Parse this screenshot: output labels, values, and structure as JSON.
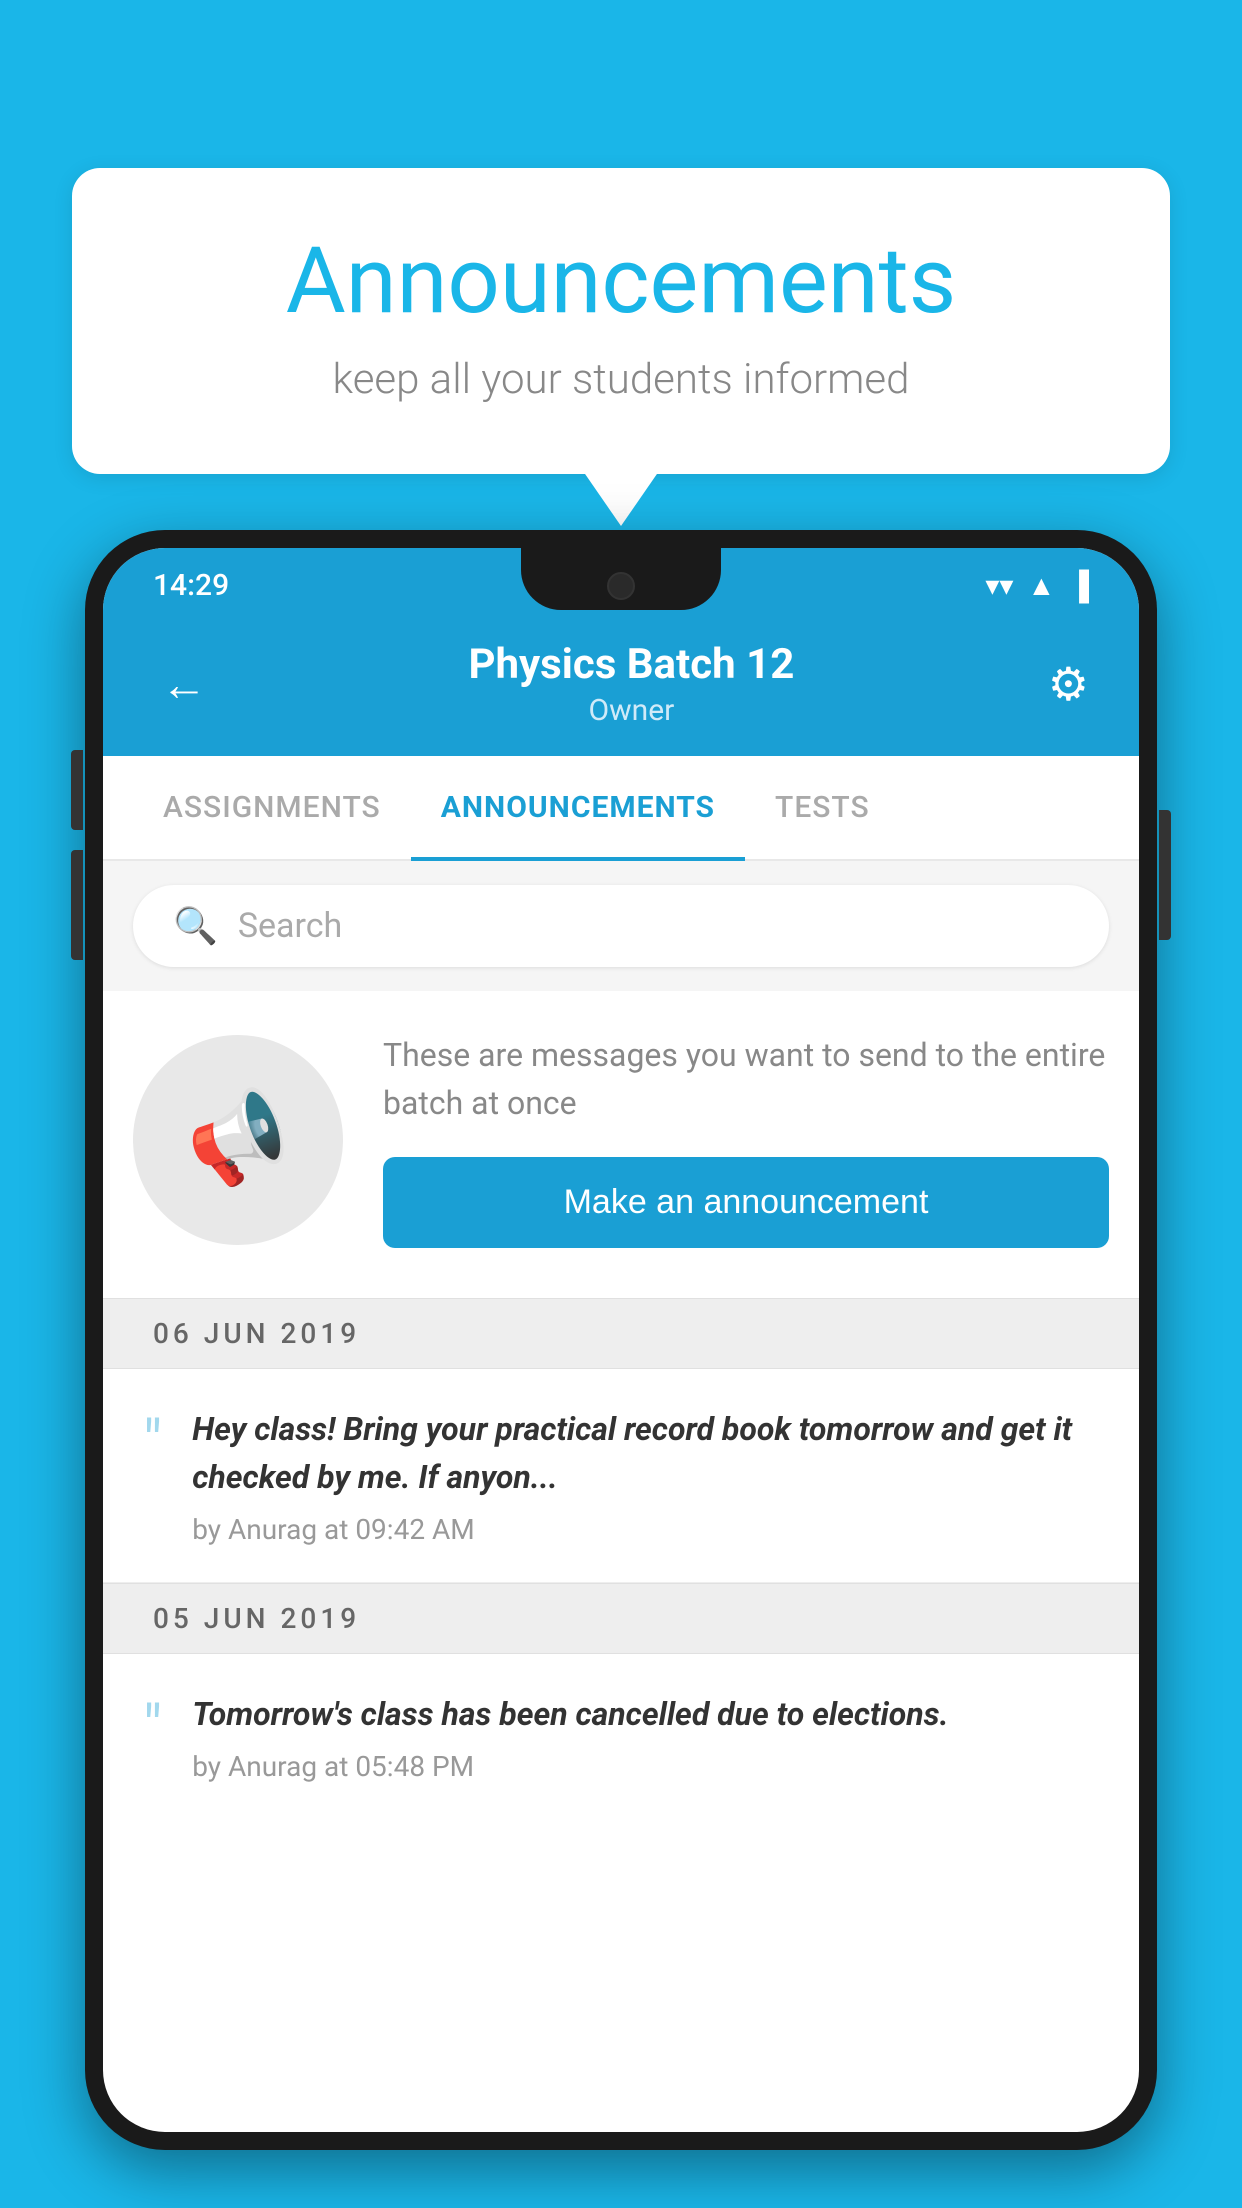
{
  "bubble": {
    "title": "Announcements",
    "subtitle": "keep all your students informed"
  },
  "status_bar": {
    "time": "14:29",
    "wifi": "▼",
    "signal": "▲",
    "battery": "▐"
  },
  "header": {
    "title": "Physics Batch 12",
    "subtitle": "Owner",
    "back_label": "←",
    "gear_label": "⚙"
  },
  "tabs": [
    {
      "label": "ASSIGNMENTS",
      "active": false
    },
    {
      "label": "ANNOUNCEMENTS",
      "active": true
    },
    {
      "label": "TESTS",
      "active": false
    }
  ],
  "search": {
    "placeholder": "Search"
  },
  "announcement_prompt": {
    "description": "These are messages you want to send to the entire batch at once",
    "button_label": "Make an announcement"
  },
  "messages": [
    {
      "date": "06  JUN  2019",
      "text": "Hey class! Bring your practical record book tomorrow and get it checked by me. If anyon...",
      "meta": "by Anurag at 09:42 AM"
    },
    {
      "date": "05  JUN  2019",
      "text": "Tomorrow's class has been cancelled due to elections.",
      "meta": "by Anurag at 05:48 PM"
    }
  ]
}
